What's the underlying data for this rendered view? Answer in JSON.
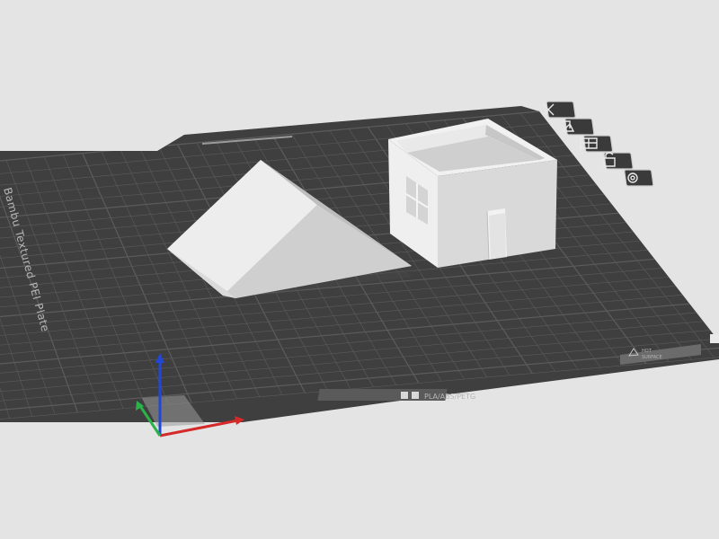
{
  "plate": {
    "name_label": "Bambu Textured PEI Plate",
    "material_label": "PLA/ABS/PETG",
    "hot_label_line1": "HOT",
    "hot_label_line2": "SURFACE"
  },
  "objects": [
    {
      "name": "roof-model"
    },
    {
      "name": "house-model"
    }
  ],
  "plate_buttons": [
    {
      "name": "clear-plate-icon"
    },
    {
      "name": "auto-orient-icon"
    },
    {
      "name": "arrange-icon"
    },
    {
      "name": "lock-plate-icon"
    },
    {
      "name": "plate-settings-icon"
    }
  ],
  "axes": {
    "x_color": "#d42a2a",
    "y_color": "#2bb34a",
    "z_color": "#2147d8"
  },
  "colors": {
    "background": "#e4e4e4",
    "plate": "#3f3f3f",
    "grid": "#5c5c5c",
    "model_light": "#e9e9e9",
    "model_mid": "#d0d0d0",
    "model_dark": "#bcbcbc"
  }
}
